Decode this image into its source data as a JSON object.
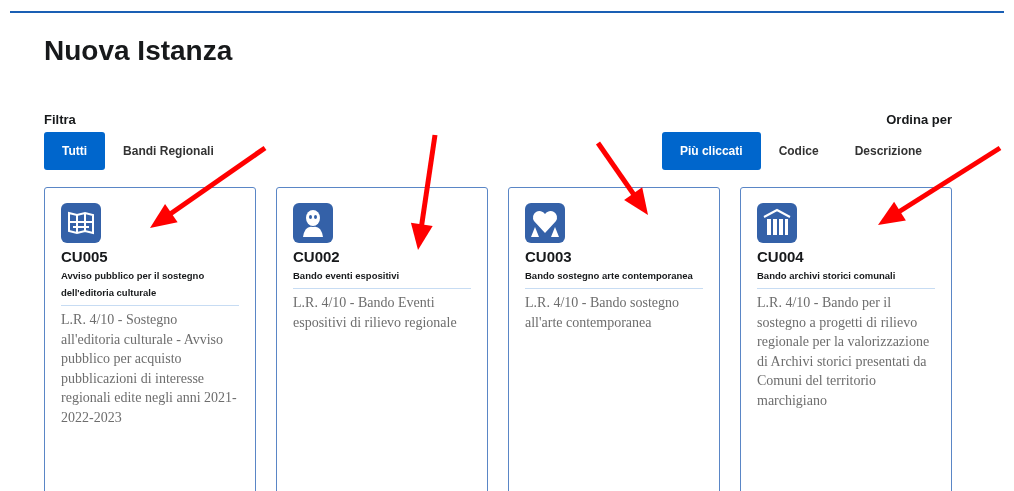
{
  "title": "Nuova Istanza",
  "filter": {
    "label": "Filtra",
    "options": [
      {
        "label": "Tutti",
        "selected": true
      },
      {
        "label": "Bandi Regionali",
        "selected": false
      }
    ]
  },
  "sort": {
    "label": "Ordina per",
    "options": [
      {
        "label": "Più cliccati",
        "selected": true
      },
      {
        "label": "Codice",
        "selected": false
      },
      {
        "label": "Descrizione",
        "selected": false
      }
    ]
  },
  "cards": [
    {
      "code": "CU005",
      "title": "Avviso pubblico per il sostegno dell'editoria culturale",
      "description": "L.R. 4/10 - Sostegno all'editoria culturale - Avviso pubblico per acquisto pubblicazioni di interesse regionali edite negli anni 2021-2022-2023"
    },
    {
      "code": "CU002",
      "title": "Bando eventi espositivi",
      "description": "L.R. 4/10 - Bando Eventi espositivi di rilievo regionale"
    },
    {
      "code": "CU003",
      "title": "Bando sostegno arte contemporanea",
      "description": "L.R. 4/10 - Bando sostegno all'arte contemporanea"
    },
    {
      "code": "CU004",
      "title": "Bando archivi storici comunali",
      "description": "L.R. 4/10 - Bando per il sostegno a progetti di rilievo regionale per la valorizzazione di Archivi storici presentati da Comuni del territorio marchigiano"
    }
  ]
}
